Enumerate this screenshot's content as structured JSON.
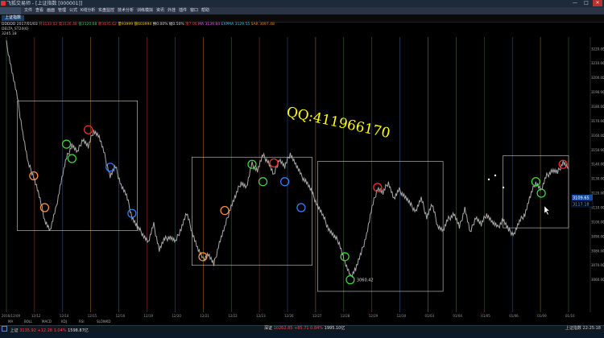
{
  "window": {
    "title": "飞狐交易师 - [上证指数 [000001]]",
    "minimize": "—",
    "maximize": "□",
    "close": "✕"
  },
  "menu": [
    "文件",
    "查看",
    "画面",
    "管理",
    "公式",
    "K线分析",
    "实盘监控",
    "技术分析",
    "训练模拟",
    "资讯",
    "外挂",
    "插件",
    "窗口",
    "帮助"
  ],
  "tab": "上证指数",
  "info": {
    "line1_parts": [
      "DDDDD",
      "2017/01/03",
      "开3133.02",
      "高3136.48",
      "低3120.68",
      "收3135.62",
      "量93999",
      "额603994",
      "换0.00%",
      "幅0.50%",
      "涨7.06",
      "MA 3139.84",
      "EXPMA 3129.55",
      "SAR 3097.48"
    ],
    "line1_colors": [
      "#dddddd",
      "#dddddd",
      "#ff4040",
      "#ff4040",
      "#30d060",
      "#ff4040",
      "#ffcc00",
      "#ffcc00",
      "#dddddd",
      "#dddddd",
      "#ff4040",
      "#ff55ff",
      "#33ccff",
      "#ff8800"
    ],
    "line2": "DELTA_ST24(6)",
    "line3": "3245.18"
  },
  "watermark": "QQ:411966170",
  "price_axis": {
    "ticks": [
      "3220.00",
      "3210.00",
      "3200.00",
      "3190.00",
      "3180.00",
      "3170.00",
      "3160.00",
      "3150.00",
      "3140.00",
      "3130.00",
      "3120.00",
      "3110.00",
      "3100.00",
      "3090.00",
      "3080.00",
      "3070.00",
      "3060.00"
    ],
    "current_label_1": "3109.65",
    "current_label_2": "3117.18"
  },
  "chart_data": {
    "type": "line",
    "title": "",
    "x_ticks": [
      "2016/12/09",
      "12/12",
      "12/14",
      "12/15",
      "12/16",
      "12/19",
      "12/20",
      "12/21",
      "12/22",
      "12/23",
      "12/26",
      "12/27",
      "12/28",
      "12/29",
      "12/30",
      "01/03",
      "01/04",
      "01/05",
      "01/06",
      "01/09",
      "01/10"
    ],
    "ylim": [
      3052,
      3226
    ],
    "series": [
      {
        "values": [
          3224,
          3205,
          3186,
          3162,
          3140,
          3132,
          3118,
          3102,
          3094,
          3108,
          3128,
          3144,
          3154,
          3148,
          3158,
          3152,
          3164,
          3159,
          3146,
          3132,
          3138,
          3126,
          3118,
          3104,
          3096,
          3092,
          3086,
          3098,
          3081,
          3088,
          3090,
          3086,
          3096,
          3106,
          3094,
          3082,
          3074,
          3078,
          3070,
          3086,
          3096,
          3110,
          3118,
          3128,
          3124,
          3140,
          3136,
          3146,
          3142,
          3132,
          3144,
          3138,
          3148,
          3140,
          3132,
          3128,
          3120,
          3112,
          3104,
          3096,
          3090,
          3086,
          3072,
          3062,
          3068,
          3078,
          3092,
          3110,
          3124,
          3120,
          3128,
          3116,
          3122,
          3118,
          3112,
          3108,
          3116,
          3104,
          3112,
          3098,
          3094,
          3102,
          3106,
          3096,
          3110,
          3092,
          3104,
          3098,
          3106,
          3100,
          3096,
          3102,
          3094,
          3092,
          3100,
          3106,
          3118,
          3128,
          3122,
          3132,
          3136,
          3134,
          3142,
          3137
        ]
      }
    ],
    "markers": [
      {
        "i": 5,
        "v": 3132,
        "c": "#ff9944"
      },
      {
        "i": 7,
        "v": 3110,
        "c": "#ff9944"
      },
      {
        "i": 11,
        "v": 3154,
        "c": "#44dd44"
      },
      {
        "i": 12,
        "v": 3144,
        "c": "#44dd44"
      },
      {
        "i": 15,
        "v": 3164,
        "c": "#ff3030"
      },
      {
        "i": 19,
        "v": 3138,
        "c": "#3388ff"
      },
      {
        "i": 23,
        "v": 3106,
        "c": "#3388ff"
      },
      {
        "i": 36,
        "v": 3076,
        "c": "#ff9944"
      },
      {
        "i": 40,
        "v": 3108,
        "c": "#ff9944"
      },
      {
        "i": 45,
        "v": 3140,
        "c": "#44dd44"
      },
      {
        "i": 47,
        "v": 3128,
        "c": "#44dd44"
      },
      {
        "i": 49,
        "v": 3141,
        "c": "#ff3030"
      },
      {
        "i": 51,
        "v": 3128,
        "c": "#3388ff"
      },
      {
        "i": 54,
        "v": 3110,
        "c": "#3388ff"
      },
      {
        "i": 62,
        "v": 3076,
        "c": "#44dd44"
      },
      {
        "i": 63,
        "v": 3060,
        "c": "#44dd44"
      },
      {
        "i": 68,
        "v": 3124,
        "c": "#ff3030"
      },
      {
        "i": 97,
        "v": 3128,
        "c": "#44dd44"
      },
      {
        "i": 98,
        "v": 3120,
        "c": "#44dd44"
      },
      {
        "i": 102,
        "v": 3140,
        "c": "#ff3030"
      }
    ],
    "boxes": [
      {
        "i0": 2,
        "i1": 24,
        "v0": 3094,
        "v1": 3184
      },
      {
        "i0": 34,
        "i1": 56,
        "v0": 3070,
        "v1": 3145
      },
      {
        "i0": 57,
        "i1": 80,
        "v0": 3052,
        "v1": 3142
      },
      {
        "i0": 91,
        "i1": 103,
        "v0": 3096,
        "v1": 3146
      }
    ],
    "low_label": "3060.42",
    "low_index": 63,
    "low_value": 3060
  },
  "indicators": [
    "MA",
    "BOLL",
    "MACD",
    "KDJ",
    "RSI",
    "SLOWKD"
  ],
  "status": {
    "q1_name": "上证",
    "q1_value": "3135.92",
    "q1_change": "+12.28",
    "q1_pct": "1.04%",
    "q1_amount": "1598.87亿",
    "q2_name": "深证",
    "q2_value": "10262.85",
    "q2_change": "+85.71",
    "q2_pct": "0.84%",
    "q2_amount": "1995.10亿",
    "index_name": "上证指数",
    "time": "22:25:18"
  }
}
